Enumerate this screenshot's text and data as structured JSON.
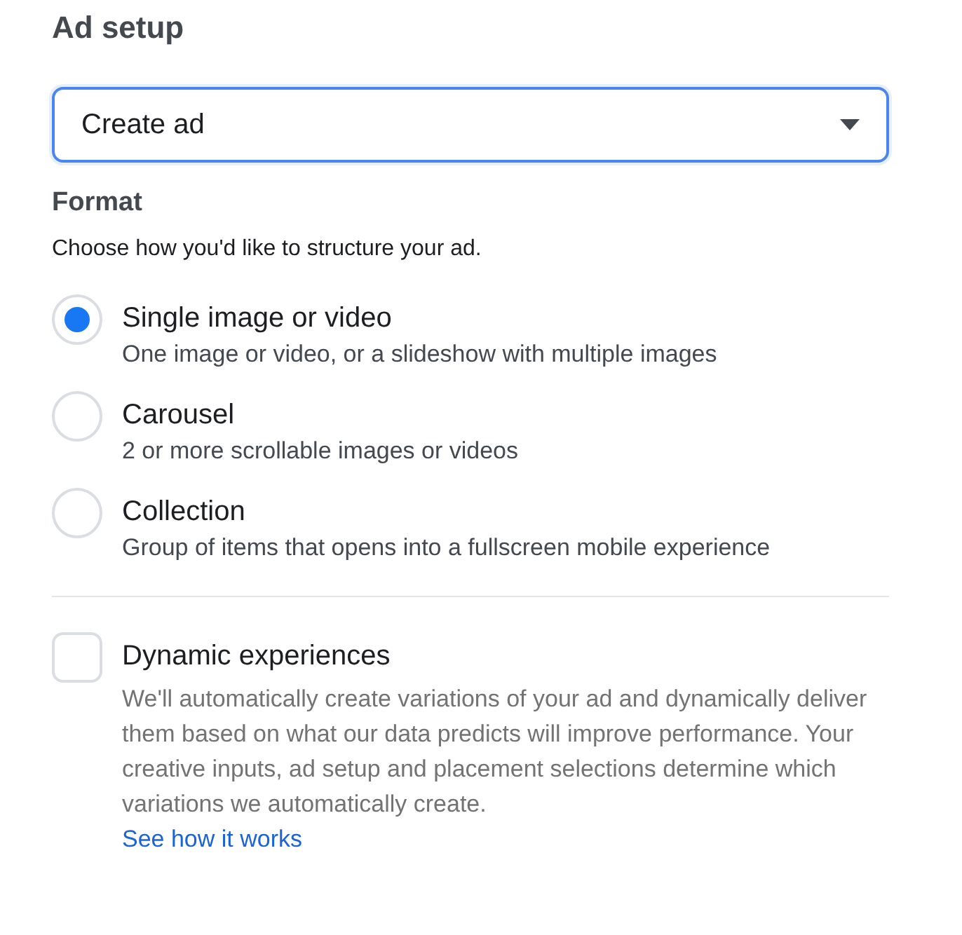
{
  "heading": "Ad setup",
  "dropdown": {
    "value": "Create ad",
    "focused": true
  },
  "format": {
    "title": "Format",
    "description": "Choose how you'd like to structure your ad."
  },
  "options": [
    {
      "label": "Single image or video",
      "description": "One image or video, or a slideshow with multiple images",
      "selected": true
    },
    {
      "label": "Carousel",
      "description": "2 or more scrollable images or videos",
      "selected": false
    },
    {
      "label": "Collection",
      "description": "Group of items that opens into a fullscreen mobile experience",
      "selected": false
    }
  ],
  "dynamic": {
    "label": "Dynamic experiences",
    "checked": false,
    "description": "We'll automatically create variations of your ad and dynamically deliver them based on what our data predicts will improve performance. Your creative inputs, ad setup and placement selections determine which variations we automatically create.",
    "link": "See how it works"
  }
}
